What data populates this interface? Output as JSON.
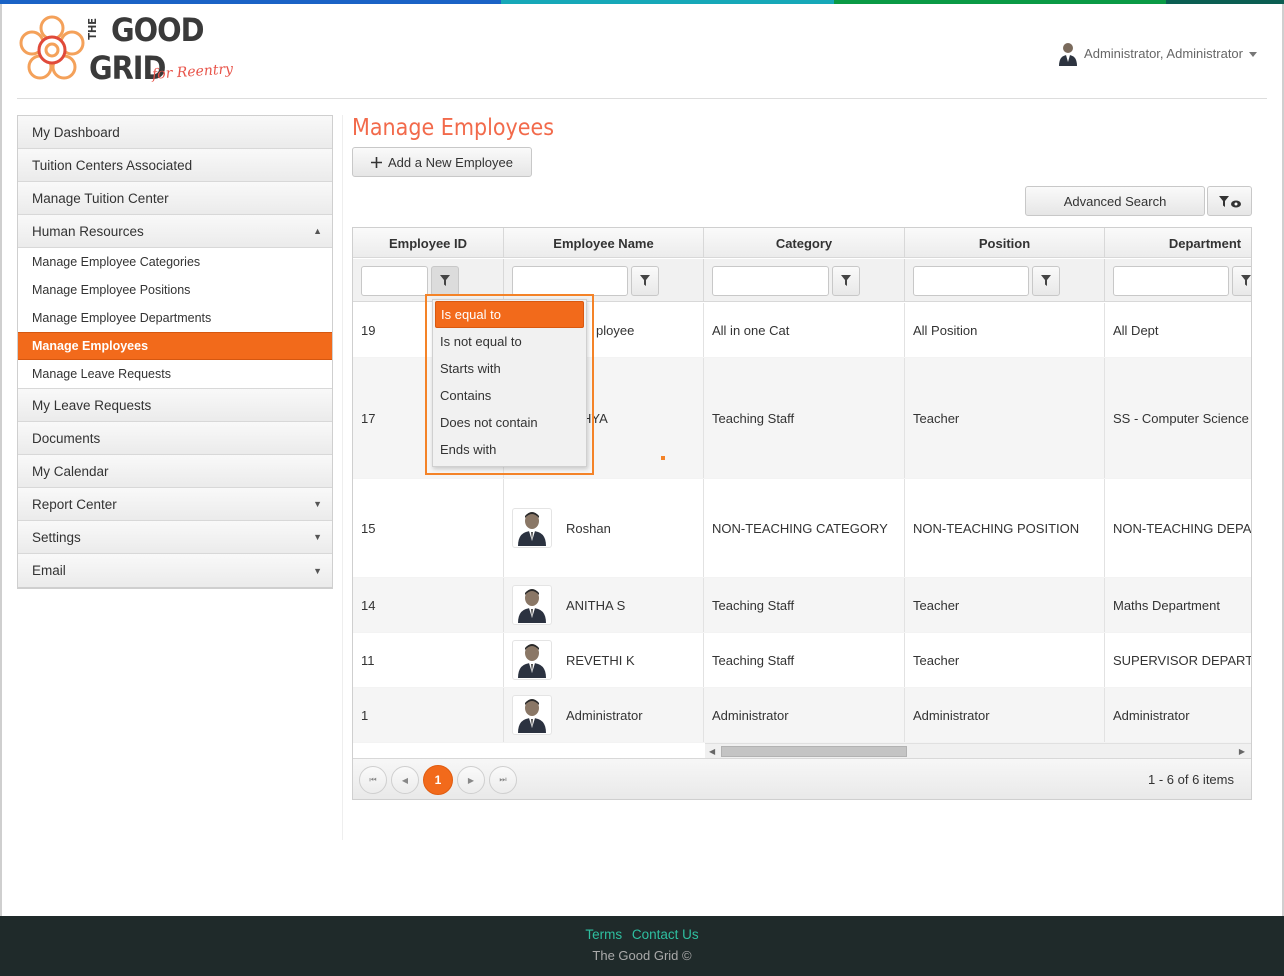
{
  "brand": {
    "line1": "THE",
    "line2": "GOOD",
    "line3": "GRID",
    "tagline": "for Reentry",
    "colors": {
      "primary": "#f26a1b",
      "title": "#f26a4b",
      "footer": "#1f2a2a",
      "link": "#2ebfa0"
    },
    "topbar_colors": [
      "#1a63c6",
      "#16a8b8",
      "#0a9a45",
      "#0b5e52"
    ]
  },
  "header": {
    "user_label": "Administrator, Administrator"
  },
  "sidebar": {
    "items": [
      {
        "label": "My Dashboard"
      },
      {
        "label": "Tuition Centers Associated"
      },
      {
        "label": "Manage Tuition Center"
      },
      {
        "label": "Human Resources",
        "arrow": "▲"
      },
      {
        "label": "My Leave Requests"
      },
      {
        "label": "Documents"
      },
      {
        "label": "My Calendar"
      },
      {
        "label": "Report Center",
        "arrow": "▼"
      },
      {
        "label": "Settings",
        "arrow": "▼"
      },
      {
        "label": "Email",
        "arrow": "▼"
      }
    ],
    "sub_items": [
      {
        "label": "Manage Employee Categories"
      },
      {
        "label": "Manage Employee Positions"
      },
      {
        "label": "Manage Employee Departments"
      },
      {
        "label": "Manage Employees"
      },
      {
        "label": "Manage Leave Requests"
      }
    ]
  },
  "main": {
    "title": "Manage Employees",
    "add_button": "Add a New Employee",
    "advanced_search": "Advanced Search"
  },
  "grid": {
    "columns": [
      "Employee ID",
      "Employee Name",
      "Category",
      "Position",
      "Department"
    ],
    "rows": [
      {
        "id": "19",
        "name": "ployee",
        "category": "All in one Cat",
        "position": "All Position",
        "department": "All Dept",
        "avatar": false
      },
      {
        "id": "17",
        "name": "HYA",
        "category": "Teaching Staff",
        "position": "Teacher",
        "department": "SS - Computer Science",
        "avatar": false
      },
      {
        "id": "15",
        "name": "Roshan",
        "category": "NON-TEACHING CATEGORY",
        "position": "NON-TEACHING POSITION",
        "department": "NON-TEACHING DEPAR",
        "avatar": true
      },
      {
        "id": "14",
        "name": "ANITHA S",
        "category": "Teaching Staff",
        "position": "Teacher",
        "department": "Maths Department",
        "avatar": true
      },
      {
        "id": "11",
        "name": "REVETHI K",
        "category": "Teaching Staff",
        "position": "Teacher",
        "department": "SUPERVISOR DEPARTMI",
        "avatar": true
      },
      {
        "id": "1",
        "name": "Administrator",
        "category": "Administrator",
        "position": "Administrator",
        "department": "Administrator",
        "avatar": true
      }
    ],
    "pager": {
      "current_page": "1",
      "info": "1 - 6 of 6 items"
    }
  },
  "filter_dropdown": {
    "options": [
      "Is equal to",
      "Is not equal to",
      "Starts with",
      "Contains",
      "Does not contain",
      "Ends with"
    ],
    "selected": "Is equal to"
  },
  "footer": {
    "terms": "Terms",
    "contact": "Contact Us",
    "copyright": "The Good Grid ©"
  }
}
